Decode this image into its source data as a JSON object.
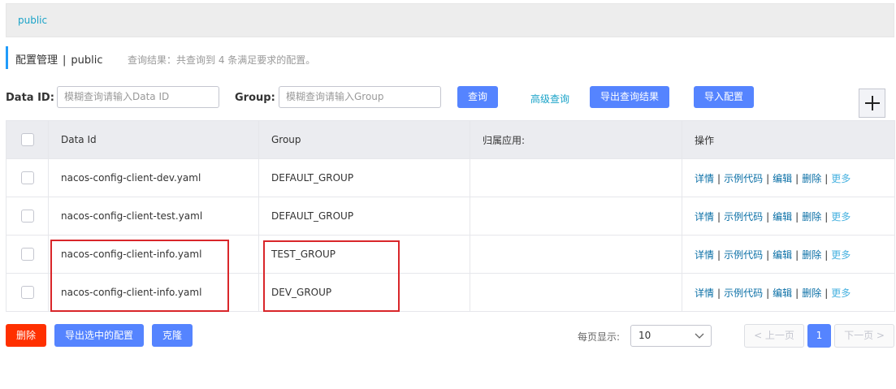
{
  "namespace_bar": {
    "items": [
      "public"
    ]
  },
  "header": {
    "title": "配置管理",
    "separator": "|",
    "namespace": "public",
    "result_text": "查询结果：共查询到 4 条满足要求的配置。"
  },
  "search": {
    "data_id_label": "Data ID:",
    "data_id_placeholder": "模糊查询请输入Data ID",
    "group_label": "Group:",
    "group_placeholder": "模糊查询请输入Group",
    "query_button": "查询",
    "advanced_link": "高级查询",
    "export_results_button": "导出查询结果",
    "import_button": "导入配置",
    "add_button": "+"
  },
  "table": {
    "columns": [
      "Data Id",
      "Group",
      "归属应用:",
      "操作"
    ],
    "rows": [
      {
        "data_id": "nacos-config-client-dev.yaml",
        "group": "DEFAULT_GROUP",
        "app": ""
      },
      {
        "data_id": "nacos-config-client-test.yaml",
        "group": "DEFAULT_GROUP",
        "app": ""
      },
      {
        "data_id": "nacos-config-client-info.yaml",
        "group": "TEST_GROUP",
        "app": ""
      },
      {
        "data_id": "nacos-config-client-info.yaml",
        "group": "DEV_GROUP",
        "app": ""
      }
    ],
    "row_actions": {
      "detail": "详情",
      "sample_code": "示例代码",
      "edit": "编辑",
      "delete": "删除",
      "more": "更多",
      "separator": "|"
    }
  },
  "footer": {
    "delete_button": "删除",
    "export_selected_button": "导出选中的配置",
    "clone_button": "克隆",
    "page_size_label": "每页显示:",
    "page_size_value": "10",
    "prev_button": "< 上一页",
    "current_page": "1",
    "next_button": "下一页 >"
  },
  "colors": {
    "primary": "#5584ff",
    "danger": "#ff3000",
    "link": "#1aa3c8",
    "highlight_border": "#d9262a"
  }
}
